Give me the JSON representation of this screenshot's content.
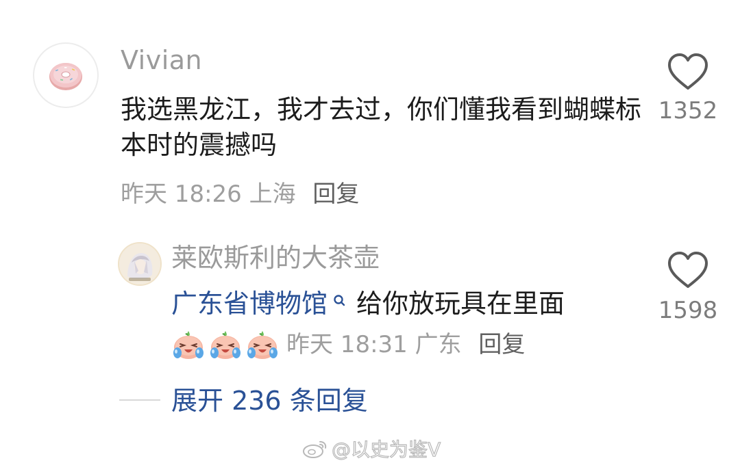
{
  "comment": {
    "username": "Vivian",
    "text": "我选黑龙江，我才去过，你们懂我看到蝴蝶标本时的震撼吗",
    "time": "昨天 18:26",
    "location": "上海",
    "reply_label": "回复",
    "likes": "1352"
  },
  "reply": {
    "username": "莱欧斯利的大茶壶",
    "link_text": "广东省博物馆",
    "text": "给你放玩具在里面",
    "emoji_count": 3,
    "time": "昨天 18:31",
    "location": "广东",
    "reply_label": "回复",
    "likes": "1598"
  },
  "expand": {
    "label": "展开 236 条回复"
  },
  "watermark": {
    "text": "@以史为鉴V"
  },
  "colors": {
    "link": "#2a5196",
    "meta": "#9e9e9e",
    "text": "#1c1c1c"
  }
}
